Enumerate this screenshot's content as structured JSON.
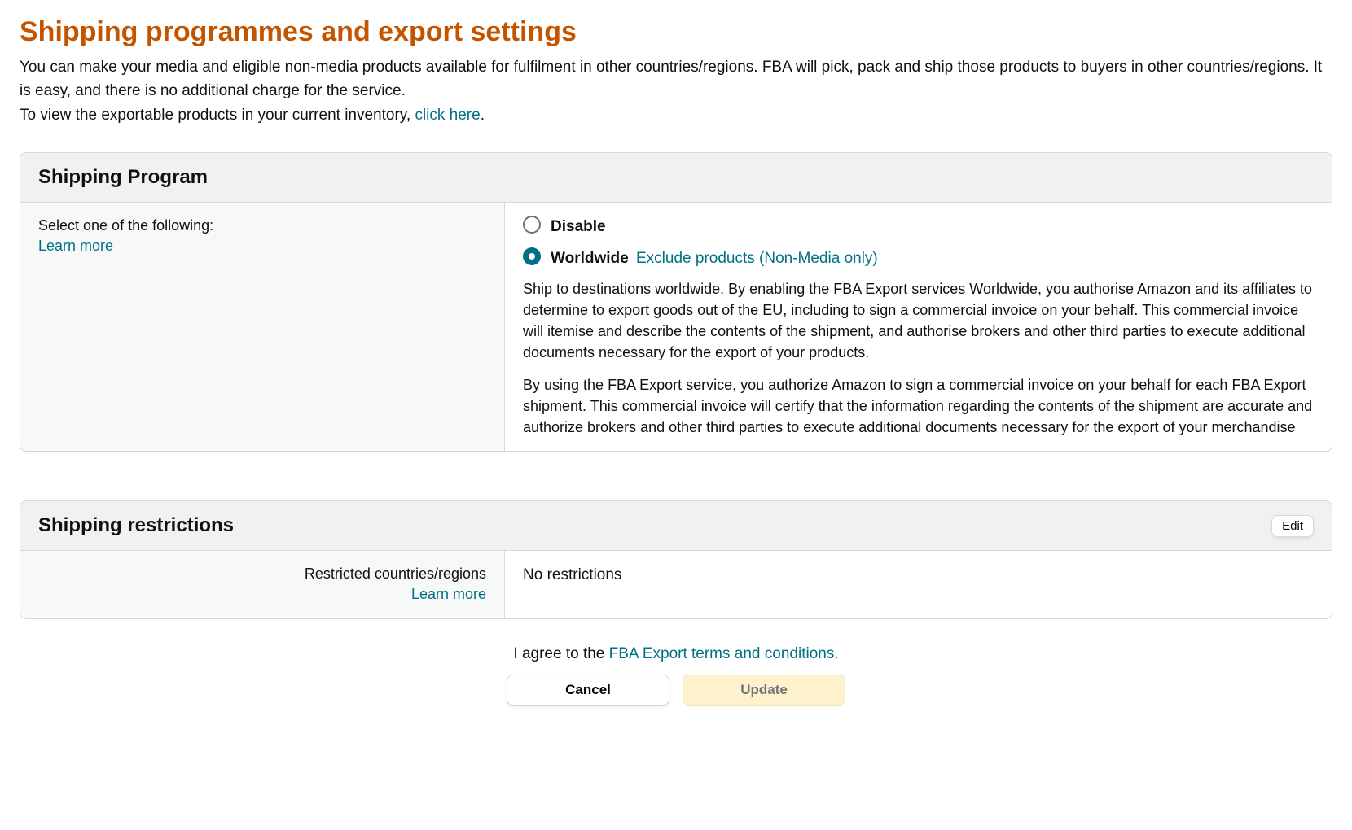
{
  "header": {
    "title": "Shipping programmes and export settings",
    "intro_line1": "You can make your media and eligible non-media products available for fulfilment in other countries/regions. FBA will pick, pack and ship those products to buyers in other countries/regions. It is easy, and there is no additional charge for the service.",
    "intro_line2_prefix": "To view the exportable products in your current inventory, ",
    "intro_link": "click here",
    "intro_line2_suffix": "."
  },
  "program": {
    "section_title": "Shipping Program",
    "select_label": "Select one of the following:",
    "learn_more": "Learn more",
    "option_disable": "Disable",
    "option_worldwide": "Worldwide",
    "exclude_link": "Exclude products (Non-Media only)",
    "desc1": "Ship to destinations worldwide. By enabling the FBA Export services Worldwide, you authorise Amazon and its affiliates to determine to export goods out of the EU, including to sign a commercial invoice on your behalf. This commercial invoice will itemise and describe the contents of the shipment, and authorise brokers and other third parties to execute additional documents necessary for the export of your products.",
    "desc2": "By using the FBA Export service, you authorize Amazon to sign a commercial invoice on your behalf for each FBA Export shipment. This commercial invoice will certify that the information regarding the contents of the shipment are accurate and authorize brokers and other third parties to execute additional documents necessary for the export of your merchandise"
  },
  "restrictions": {
    "section_title": "Shipping restrictions",
    "edit_label": "Edit",
    "left_label": "Restricted countries/regions",
    "learn_more": "Learn more",
    "value": "No restrictions"
  },
  "footer": {
    "agree_prefix": "I agree to the ",
    "agree_link": "FBA Export terms and conditions.",
    "cancel": "Cancel",
    "update": "Update"
  }
}
